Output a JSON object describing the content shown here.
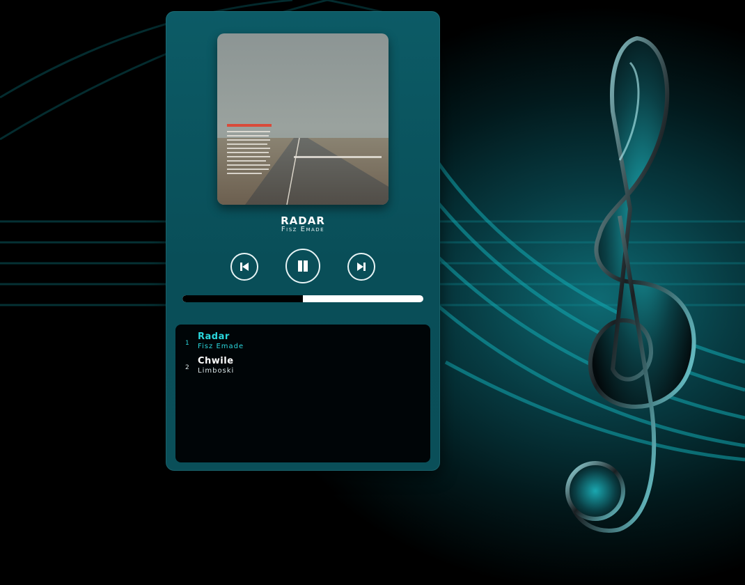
{
  "now_playing": {
    "title": "RADAR",
    "artist": "Fisz Emade",
    "progress": 0.5
  },
  "controls": {
    "prev_icon": "skip-previous-icon",
    "play_icon": "pause-icon",
    "next_icon": "skip-next-icon"
  },
  "playlist": [
    {
      "number": "1",
      "title": "Radar",
      "artist": "Fisz Emade",
      "active": true
    },
    {
      "number": "2",
      "title": "Chwile",
      "artist": "Limboski",
      "active": false
    }
  ],
  "colors": {
    "accent": "#2ad6dc",
    "player_bg": "#0a5560",
    "playlist_bg": "#000507"
  }
}
